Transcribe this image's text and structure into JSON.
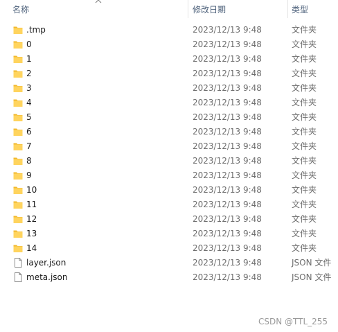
{
  "columns": {
    "name": "名称",
    "date_modified": "修改日期",
    "type": "类型"
  },
  "sort": {
    "column": "name",
    "direction": "ascending",
    "icon": "chevron-up-icon"
  },
  "files": [
    {
      "name": ".tmp",
      "date": "2023/12/13 9:48",
      "type": "文件夹",
      "icon": "folder-icon"
    },
    {
      "name": "0",
      "date": "2023/12/13 9:48",
      "type": "文件夹",
      "icon": "folder-icon"
    },
    {
      "name": "1",
      "date": "2023/12/13 9:48",
      "type": "文件夹",
      "icon": "folder-icon"
    },
    {
      "name": "2",
      "date": "2023/12/13 9:48",
      "type": "文件夹",
      "icon": "folder-icon"
    },
    {
      "name": "3",
      "date": "2023/12/13 9:48",
      "type": "文件夹",
      "icon": "folder-icon"
    },
    {
      "name": "4",
      "date": "2023/12/13 9:48",
      "type": "文件夹",
      "icon": "folder-icon"
    },
    {
      "name": "5",
      "date": "2023/12/13 9:48",
      "type": "文件夹",
      "icon": "folder-icon"
    },
    {
      "name": "6",
      "date": "2023/12/13 9:48",
      "type": "文件夹",
      "icon": "folder-icon"
    },
    {
      "name": "7",
      "date": "2023/12/13 9:48",
      "type": "文件夹",
      "icon": "folder-icon"
    },
    {
      "name": "8",
      "date": "2023/12/13 9:48",
      "type": "文件夹",
      "icon": "folder-icon"
    },
    {
      "name": "9",
      "date": "2023/12/13 9:48",
      "type": "文件夹",
      "icon": "folder-icon"
    },
    {
      "name": "10",
      "date": "2023/12/13 9:48",
      "type": "文件夹",
      "icon": "folder-icon"
    },
    {
      "name": "11",
      "date": "2023/12/13 9:48",
      "type": "文件夹",
      "icon": "folder-icon"
    },
    {
      "name": "12",
      "date": "2023/12/13 9:48",
      "type": "文件夹",
      "icon": "folder-icon"
    },
    {
      "name": "13",
      "date": "2023/12/13 9:48",
      "type": "文件夹",
      "icon": "folder-icon"
    },
    {
      "name": "14",
      "date": "2023/12/13 9:48",
      "type": "文件夹",
      "icon": "folder-icon"
    },
    {
      "name": "layer.json",
      "date": "2023/12/13 9:48",
      "type": "JSON 文件",
      "icon": "file-icon"
    },
    {
      "name": "meta.json",
      "date": "2023/12/13 9:48",
      "type": "JSON 文件",
      "icon": "file-icon"
    }
  ],
  "watermark": "CSDN @TTL_255",
  "colors": {
    "folder": "#ffd45e",
    "folder_tab": "#f2b92e",
    "header_text": "#4c607a",
    "secondary_text": "#6d6d6d"
  }
}
